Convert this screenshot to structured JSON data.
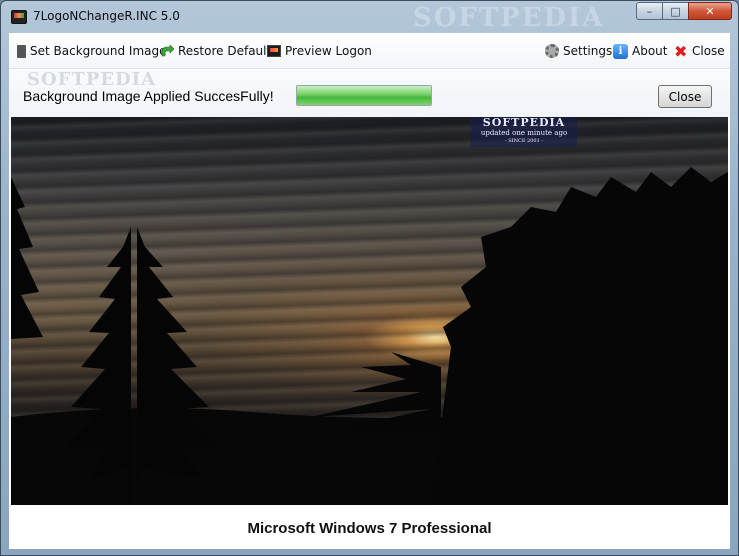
{
  "window": {
    "title": "7LogoNChangeR.INC 5.0",
    "watermark": "SOFTPEDIA",
    "minimize_glyph": "–",
    "maximize_glyph": "□",
    "close_glyph": "✕"
  },
  "toolbar": {
    "set_background": {
      "label": "Set Background Image",
      "icon": "document-icon"
    },
    "restore_default": {
      "label": "Restore Default",
      "icon": "restore-arrow-icon"
    },
    "preview_logon": {
      "label": "Preview Logon",
      "icon": "monitor-icon"
    },
    "settings": {
      "label": "Settings",
      "icon": "gear-icon"
    },
    "about": {
      "label": "About",
      "icon": "info-icon",
      "glyph": "i"
    },
    "close": {
      "label": "Close",
      "icon": "close-x-icon",
      "glyph": "✖"
    }
  },
  "status": {
    "message": "Background Image Applied SuccesFully!",
    "progress": 1.0,
    "close_button": "Close",
    "watermark": "SOFTPEDIA"
  },
  "preview": {
    "badge_title": "SOFTPEDIA",
    "badge_line": "updated one minute ago",
    "badge_since": "- SINCE 2001 -"
  },
  "footer": {
    "os_name": "Microsoft Windows 7 Professional"
  },
  "colors": {
    "close_x": "#e01c1c",
    "progress_green": "#45b83a",
    "title_bar": "#98b2ca"
  }
}
